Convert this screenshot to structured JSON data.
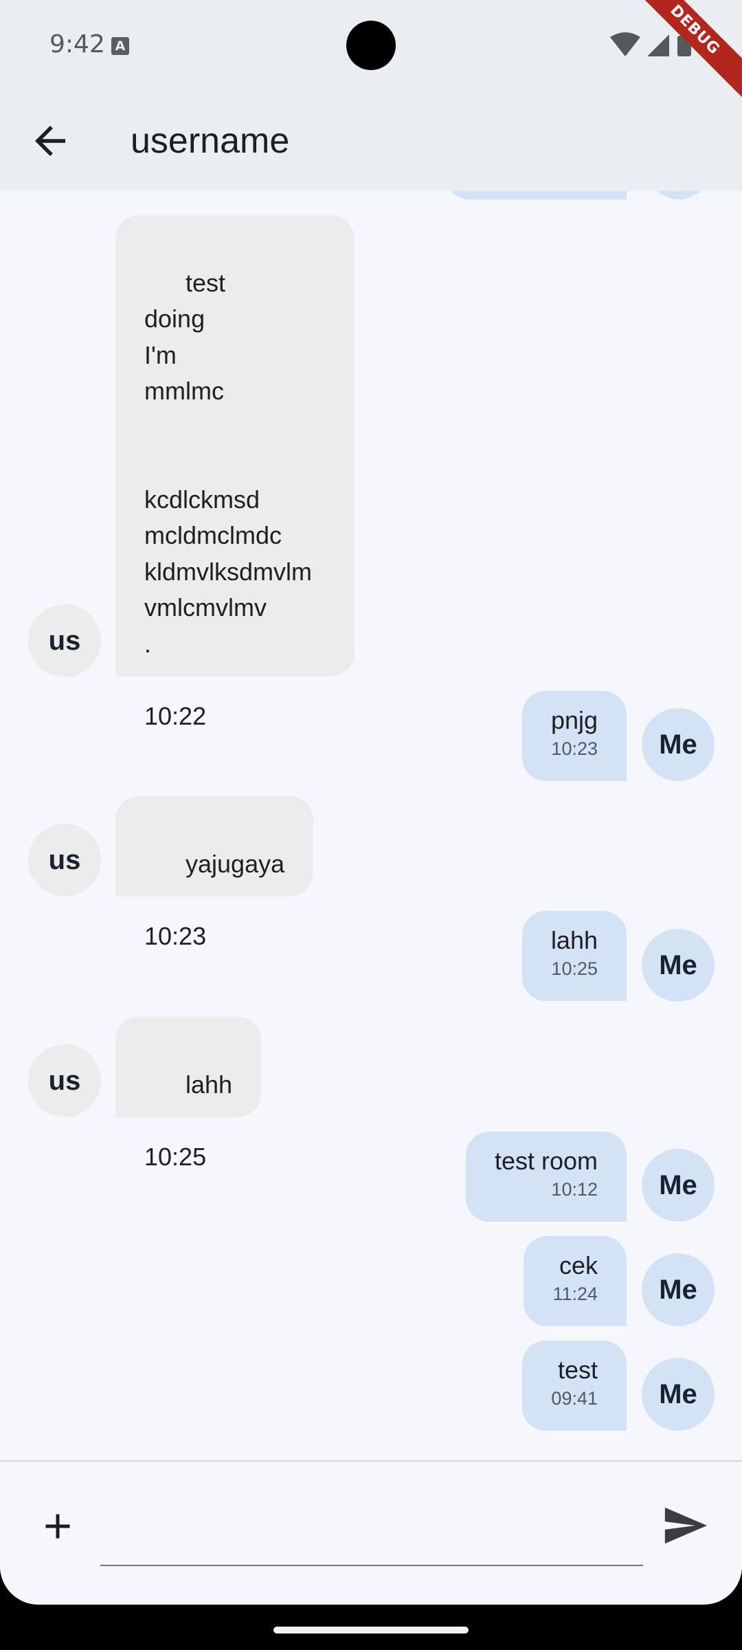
{
  "status_bar": {
    "time": "9:42"
  },
  "debug_banner": "DEBUG",
  "app_bar": {
    "title": "username"
  },
  "messages": [
    {
      "sender": "us",
      "text": "test\ndoing\nI'm\nmmlmc\n\n\nkcdlckmsd\nmcldmclmdc\nkldmvlksdmvlm\nvmlcmvlmv\n.",
      "time": "10:22"
    },
    {
      "sender": "Me",
      "text": "pnjg",
      "time": "10:23"
    },
    {
      "sender": "us",
      "text": "yajugaya",
      "time": "10:23"
    },
    {
      "sender": "Me",
      "text": "lahh",
      "time": "10:25"
    },
    {
      "sender": "us",
      "text": "lahh",
      "time": "10:25"
    },
    {
      "sender": "Me",
      "text": "test room",
      "time": "10:12"
    },
    {
      "sender": "Me",
      "text": "cek",
      "time": "11:24"
    },
    {
      "sender": "Me",
      "text": "test",
      "time": "09:41"
    }
  ],
  "composer": {
    "value": "",
    "placeholder": ""
  },
  "icons": {
    "back": "arrow-back-icon",
    "add": "plus-icon",
    "send": "send-icon"
  },
  "colors": {
    "incoming_bubble": "#ececec",
    "outgoing_bubble": "#d3e3f5",
    "app_bar": "#eaedf2",
    "background": "#f6f7fc"
  }
}
